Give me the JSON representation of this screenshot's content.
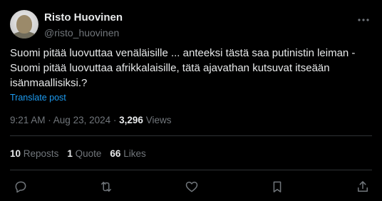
{
  "author": {
    "display_name": "Risto Huovinen",
    "handle": "@risto_huovinen"
  },
  "tweet": {
    "text": "Suomi pitää luovuttaa venäläisille ... anteeksi tästä saa putinistin leiman - Suomi pitää luovuttaa afrikkalaisille, tätä ajavathan kutsuvat itseään isänmaallisiksi.?",
    "translate_label": "Translate post"
  },
  "meta": {
    "time": "9:21 AM",
    "separator": " · ",
    "date": "Aug 23, 2024",
    "views_count": "3,296",
    "views_label": "Views"
  },
  "stats": {
    "reposts_count": "10",
    "reposts_label": "Reposts",
    "quotes_count": "1",
    "quotes_label": "Quote",
    "likes_count": "66",
    "likes_label": "Likes"
  },
  "icons": {
    "more": "more-icon",
    "reply": "reply-icon",
    "repost": "repost-icon",
    "like": "heart-icon",
    "bookmark": "bookmark-icon",
    "share": "share-icon"
  },
  "colors": {
    "background": "#000000",
    "text": "#e7e9ea",
    "muted": "#71767b",
    "link": "#1d9bf0",
    "divider": "#2f3336"
  }
}
